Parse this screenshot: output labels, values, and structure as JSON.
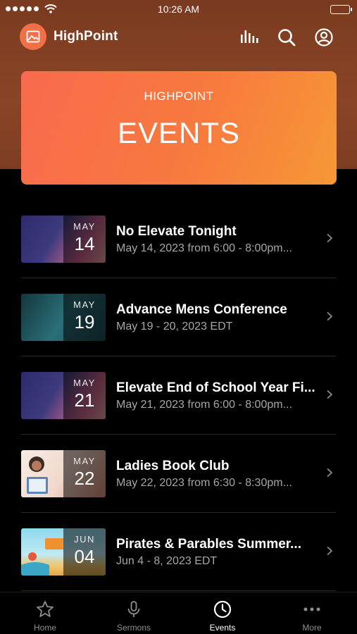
{
  "status_bar": {
    "time": "10:26 AM"
  },
  "header": {
    "app_name": "HighPoint"
  },
  "banner": {
    "brand": "HIGHPOINT",
    "title": "EVENTS"
  },
  "events": [
    {
      "title": "No Elevate Tonight",
      "subtitle": "May 14, 2023 from 6:00 - 8:00pm...",
      "month": "MAY",
      "day": "14",
      "thumb_colors": [
        "#3a2d6a",
        "#d26a8a"
      ]
    },
    {
      "title": "Advance Mens Conference",
      "subtitle": "May 19 - 20, 2023 EDT",
      "month": "MAY",
      "day": "19",
      "thumb_colors": [
        "#1d4d55",
        "#2f7e86"
      ]
    },
    {
      "title": "Elevate End of School Year Fi...",
      "subtitle": "May 21, 2023 from 6:00 - 8:00pm...",
      "month": "MAY",
      "day": "21",
      "thumb_colors": [
        "#3a2d6a",
        "#d26a8a"
      ]
    },
    {
      "title": "Ladies Book Club",
      "subtitle": "May 22, 2023 from 6:30 - 8:30pm...",
      "month": "MAY",
      "day": "22",
      "thumb_colors": [
        "#f4e6dc",
        "#d98f7a"
      ]
    },
    {
      "title": "Pirates & Parables Summer...",
      "subtitle": "Jun 4 - 8, 2023 EDT",
      "month": "JUN",
      "day": "04",
      "thumb_colors": [
        "#7fd0e8",
        "#f2c66a"
      ]
    }
  ],
  "tabs": [
    {
      "label": "Home",
      "icon": "star-icon",
      "active": false
    },
    {
      "label": "Sermons",
      "icon": "microphone-icon",
      "active": false
    },
    {
      "label": "Events",
      "icon": "clock-icon",
      "active": true
    },
    {
      "label": "More",
      "icon": "more-dots-icon",
      "active": false
    }
  ],
  "colors": {
    "header_bg": "#7a3a1f",
    "banner_start": "#f86a4e",
    "banner_end": "#f69836",
    "accent": "#f07048"
  }
}
